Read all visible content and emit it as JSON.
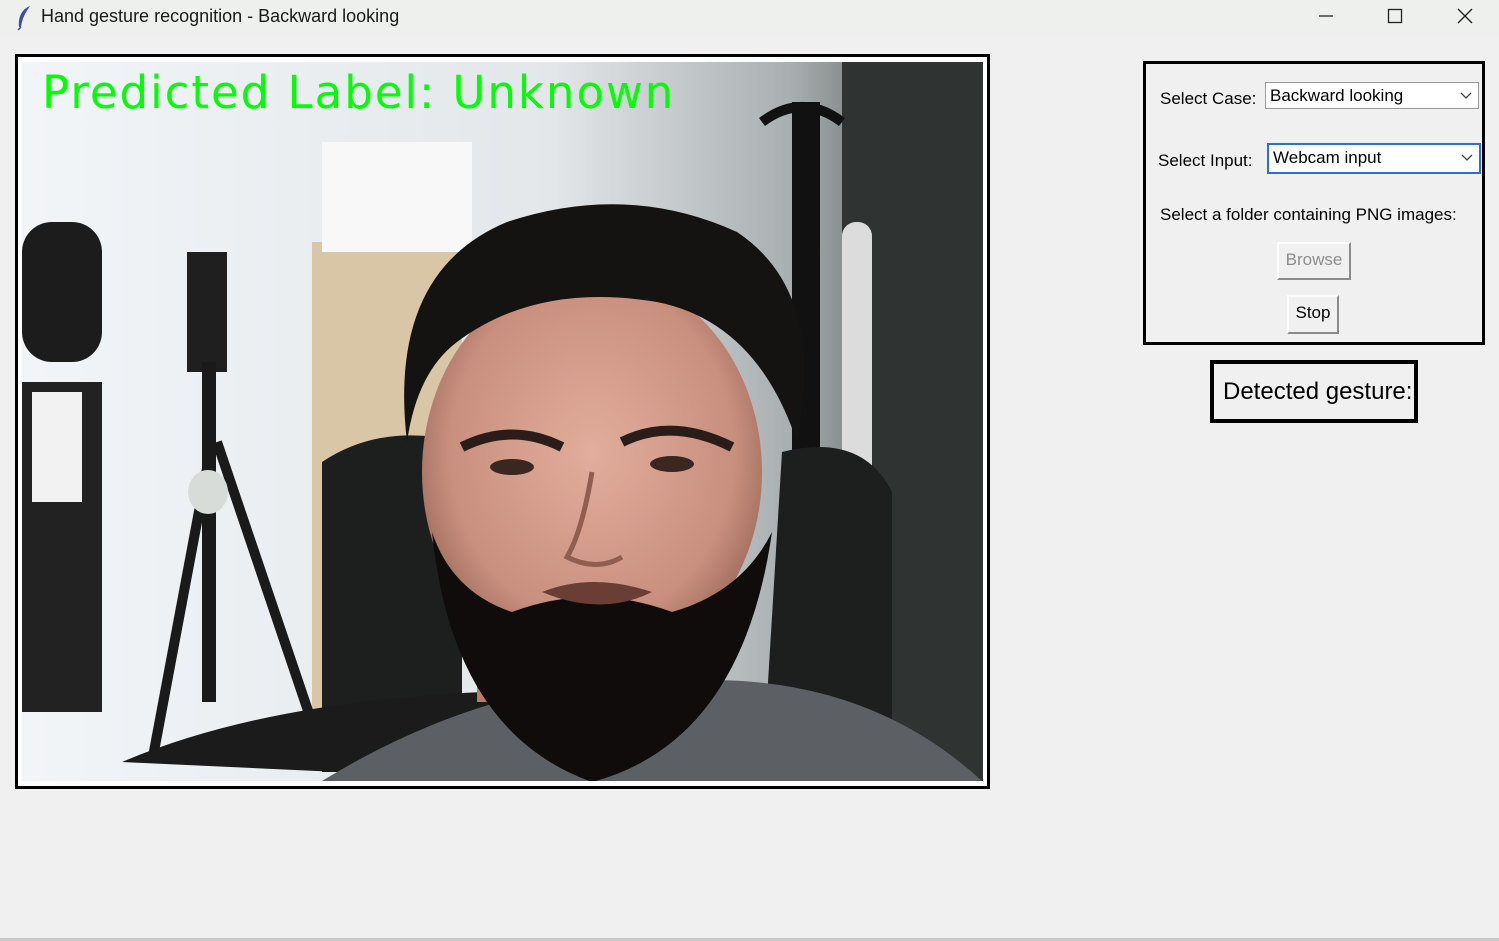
{
  "window": {
    "title": "Hand gesture recognition - Backward looking",
    "icon": "feather-icon"
  },
  "video": {
    "overlay_text": "Predicted Label: Unknown",
    "overlay_color": "#00ff00"
  },
  "controls": {
    "case_label": "Select Case:",
    "case_value": "Backward looking",
    "input_label": "Select Input:",
    "input_value": "Webcam input",
    "folder_label": "Select a folder containing PNG images:",
    "browse_label": "Browse",
    "stop_label": "Stop"
  },
  "gesture": {
    "label": "Detected gesture:"
  },
  "colors": {
    "focus_border": "#2a6fd4",
    "disabled_text": "#8d8d8d"
  }
}
